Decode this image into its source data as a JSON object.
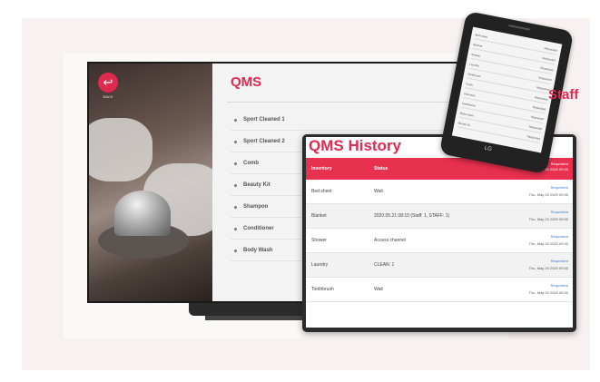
{
  "tv": {
    "back_label": "BACK",
    "title": "QMS",
    "items": [
      "Sport Cleaned 1",
      "Sport Cleaned 2",
      "Comb",
      "Beauty Kit",
      "Shampoo",
      "Conditioner",
      "Body Wash"
    ]
  },
  "tablet": {
    "title": "QMS History",
    "columns": [
      "Inventory",
      "Status",
      "Requested\nThu, May 20 2020 09:30"
    ],
    "rows": [
      {
        "item": "Bed sheet",
        "status": "Wait",
        "link": "Requested",
        "time": "Thu, May 20 2020 09:30"
      },
      {
        "item": "Blanket",
        "status": "2020.05.21 08:10 (Staff: 1, STAFF: 1)",
        "link": "Requested",
        "time": "Thu, May 20 2020 09:30"
      },
      {
        "item": "Shower",
        "status": "Access channel",
        "link": "Requested",
        "time": "Thu, May 20 2020 09:30"
      },
      {
        "item": "Laundry",
        "status": "CLEAN: 1",
        "link": "Requested",
        "time": "Thu, May 20 2020 09:30"
      },
      {
        "item": "Toothbrush",
        "status": "Wait",
        "link": "Requested",
        "time": "Thu, May 20 2020 09:30"
      }
    ]
  },
  "phone": {
    "rows": [
      {
        "a": "Bed sheet",
        "b": "Requested"
      },
      {
        "a": "Blanket",
        "b": "Requested"
      },
      {
        "a": "Shower",
        "b": "Requested"
      },
      {
        "a": "Laundry",
        "b": "Requested"
      },
      {
        "a": "Toothbrush",
        "b": "Requested"
      },
      {
        "a": "Comb",
        "b": "Requested"
      },
      {
        "a": "Shampoo",
        "b": "Requested"
      },
      {
        "a": "Conditioner",
        "b": "Requested"
      },
      {
        "a": "Body Wash",
        "b": "Requested"
      },
      {
        "a": "Beauty Kit",
        "b": "Requested"
      }
    ],
    "logo": "LG"
  },
  "staff_label": "Staff",
  "colors": {
    "accent": "#e0294f",
    "header": "#e8304f",
    "link": "#3a7bd5"
  }
}
